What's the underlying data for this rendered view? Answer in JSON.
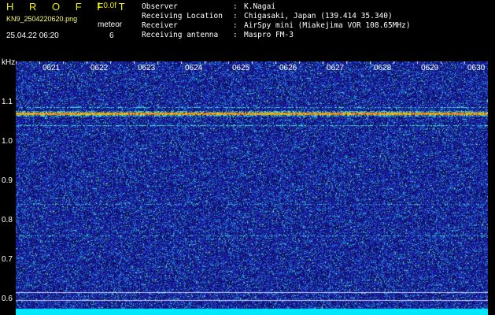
{
  "header": {
    "title": "H R O F F T",
    "version": "1.0.0f",
    "filename": "KN9_2504220620.png",
    "datetime": "25.04.22 06:20",
    "meteor_label": "meteor",
    "meteor_count": "6"
  },
  "info": [
    {
      "key": "Observer",
      "value": "K.Nagai"
    },
    {
      "key": "Receiving Location",
      "value": "Chigasaki, Japan (139.414 35.340)"
    },
    {
      "key": "Receiver",
      "value": "AirSpy mini (Miakejima VOR 108.65MHz)"
    },
    {
      "key": "Receiving antenna",
      "value": "Maspro FM-3"
    }
  ],
  "axis": {
    "y_unit": "kHz",
    "y_ticks": [
      "1.1",
      "1.0",
      "0.9",
      "0.8",
      "0.7",
      "0.6"
    ],
    "time_ticks": [
      "0621",
      "0622",
      "0623",
      "0624",
      "0625",
      "0626",
      "0627",
      "0628",
      "0629",
      "0630"
    ]
  },
  "colors": {
    "background": "#1a1aa8",
    "carrier": "#e8c800",
    "carrier_core": "#d02020",
    "header_text": "#f4f400"
  }
}
